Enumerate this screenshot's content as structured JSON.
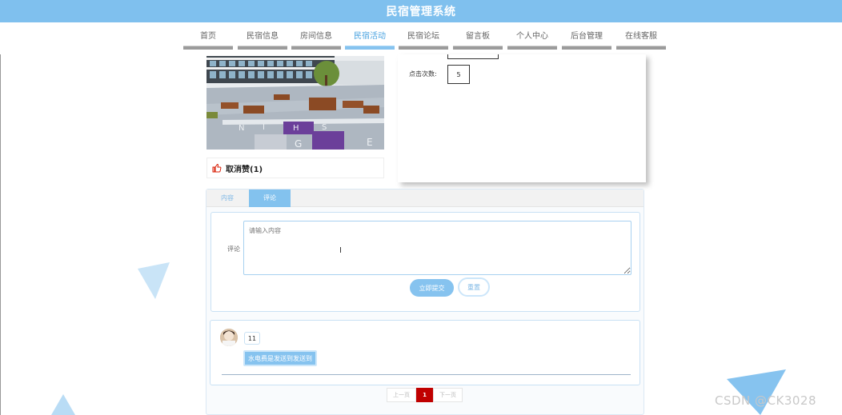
{
  "app": {
    "title": "民宿管理系统"
  },
  "nav": {
    "items": [
      {
        "label": "首页",
        "active": false
      },
      {
        "label": "民宿信息",
        "active": false
      },
      {
        "label": "房间信息",
        "active": false
      },
      {
        "label": "民宿活动",
        "active": true
      },
      {
        "label": "民宿论坛",
        "active": false
      },
      {
        "label": "留言板",
        "active": false
      },
      {
        "label": "个人中心",
        "active": false
      },
      {
        "label": "后台管理",
        "active": false
      },
      {
        "label": "在线客服",
        "active": false
      }
    ]
  },
  "detail": {
    "like_label": "取消赞(1)",
    "click_label": "点击次数:",
    "click_value": "5"
  },
  "tabs": {
    "content": "内容",
    "comment": "评论",
    "active": "comment"
  },
  "comment_form": {
    "label": "评论",
    "placeholder": "请输入内容",
    "submit_label": "立即提交",
    "reset_label": "重置"
  },
  "comments": [
    {
      "user": "11",
      "text": "水电费是发送到发送到"
    }
  ],
  "pagination": {
    "prev": "上一页",
    "current": "1",
    "next": "下一页"
  },
  "colors": {
    "header": "#7fc0ee",
    "accent": "#86c3ef",
    "page_active": "#c00000"
  },
  "watermark": "CSDN @CK3028"
}
